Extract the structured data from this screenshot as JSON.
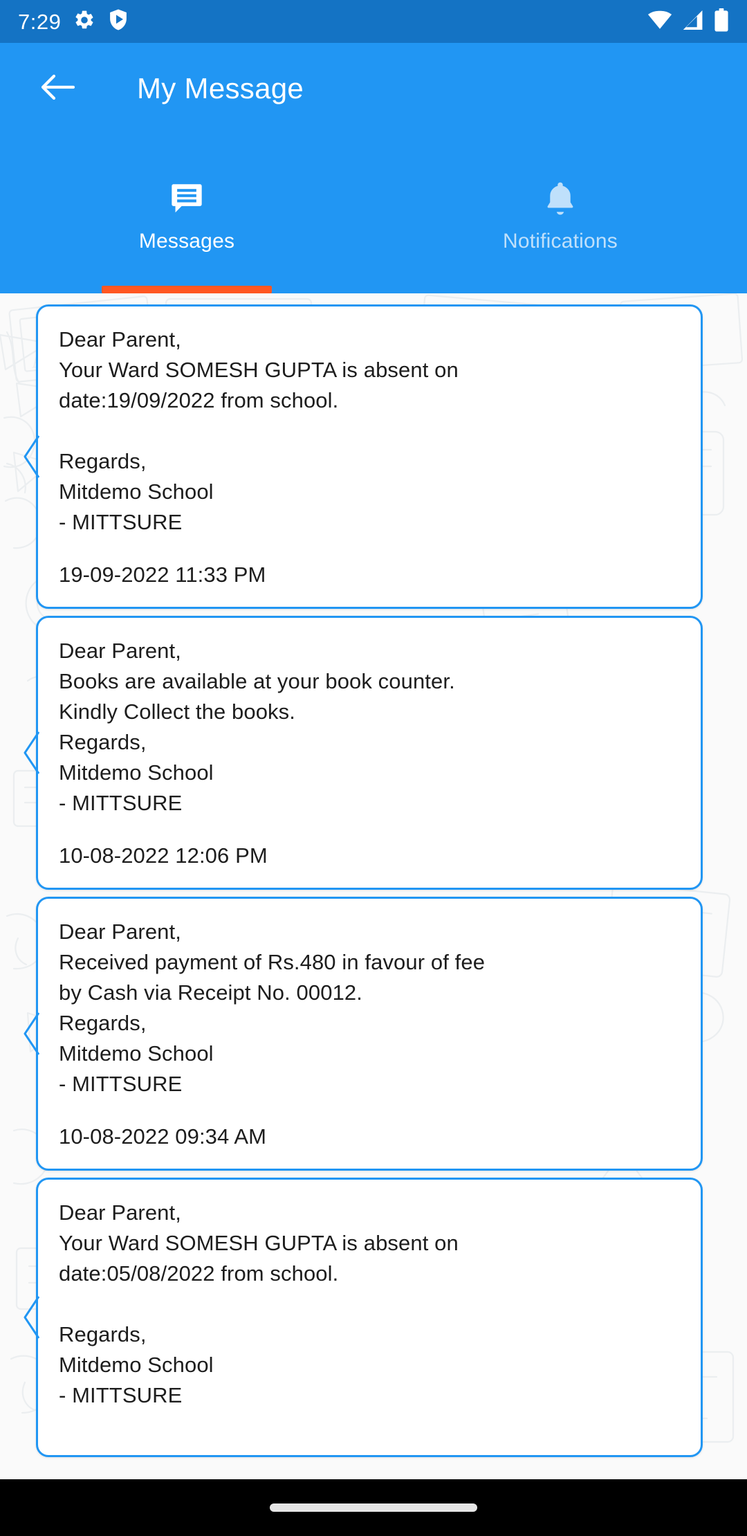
{
  "status_bar": {
    "time": "7:29",
    "left_icons": [
      "gear-icon",
      "play-protect-shield-icon"
    ],
    "right_icons": [
      "wifi-icon",
      "cellular-signal-icon",
      "battery-icon"
    ],
    "background_color": "#1473c4"
  },
  "app_bar": {
    "title": "My Message",
    "back_icon": "back-arrow-icon",
    "background_color": "#2196f3"
  },
  "tabs": {
    "active_index": 0,
    "indicator_color": "#ff5722",
    "items": [
      {
        "label": "Messages",
        "icon": "chat-bubble-icon",
        "active": true
      },
      {
        "label": "Notifications",
        "icon": "bell-icon",
        "active": false
      }
    ]
  },
  "messages": [
    {
      "body": "Dear Parent,\nYour Ward SOMESH GUPTA is absent on\ndate:19/09/2022 from school.\n\nRegards,\nMitdemo School\n- MITTSURE",
      "timestamp": "19-09-2022 11:33 PM"
    },
    {
      "body": "Dear Parent,\nBooks are available at your book counter.\nKindly Collect the books.\nRegards,\nMitdemo School\n- MITTSURE",
      "timestamp": "10-08-2022 12:06 PM"
    },
    {
      "body": "Dear Parent,\nReceived payment of Rs.480 in favour of fee\nby Cash via Receipt No. 00012.\nRegards,\nMitdemo School\n- MITTSURE",
      "timestamp": "10-08-2022 09:34 AM"
    },
    {
      "body": "Dear Parent,\nYour Ward SOMESH GUPTA is absent on\ndate:05/08/2022 from school.\n\nRegards,\nMitdemo School\n- MITTSURE",
      "timestamp": ""
    }
  ],
  "nav_bar": {
    "gesture_pill": "home-gesture-pill",
    "background_color": "#000000"
  },
  "theme": {
    "accent": "#2196f3",
    "indicator": "#ff5722",
    "card_border": "#2196f3",
    "content_background": "#fafafa"
  }
}
